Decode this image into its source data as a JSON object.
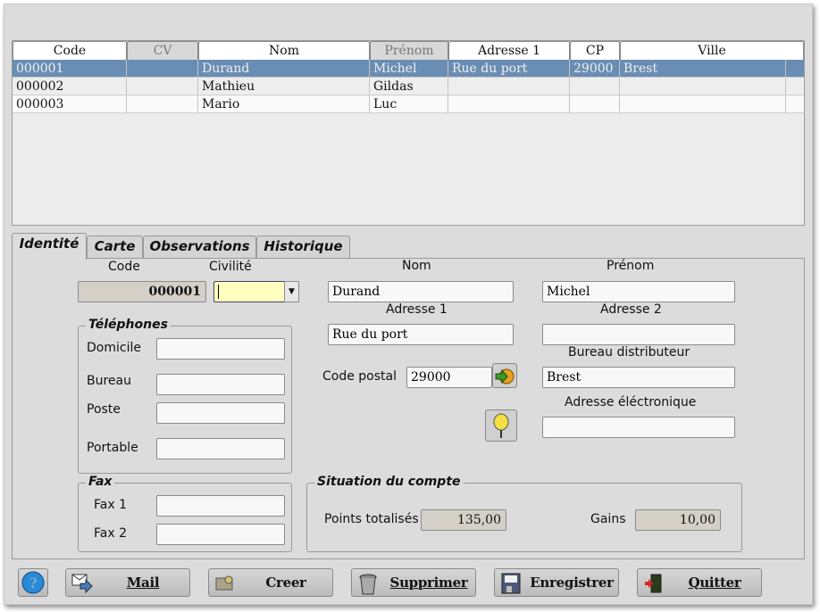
{
  "grid": {
    "columns": [
      "Code",
      "CV",
      "Nom",
      "Prénom",
      "Adresse 1",
      "CP",
      "Ville"
    ],
    "rows": [
      [
        "000001",
        "",
        "Durand",
        "Michel",
        "Rue du port",
        "29000",
        "Brest"
      ],
      [
        "000002",
        "",
        "Mathieu",
        "Gildas",
        "",
        "",
        ""
      ],
      [
        "000003",
        "",
        "Mario",
        "Luc",
        "",
        "",
        ""
      ]
    ],
    "selected_row": 0
  },
  "tabs": [
    "Identité",
    "Carte",
    "Observations",
    "Historique"
  ],
  "active_tab": "Identité",
  "form": {
    "code_label": "Code",
    "code_value": "000001",
    "civilite_label": "Civilité",
    "civilite_value": "",
    "nom_label": "Nom",
    "nom_value": "Durand",
    "prenom_label": "Prénom",
    "prenom_value": "Michel",
    "adresse1_label": "Adresse 1",
    "adresse1_value": "Rue du port",
    "adresse2_label": "Adresse 2",
    "adresse2_value": "",
    "cp_label": "Code postal",
    "cp_value": "29000",
    "bureau_label": "Bureau distributeur",
    "bureau_value": "Brest",
    "email_label": "Adresse éléctronique",
    "email_value": "",
    "telephones": {
      "title": "Téléphones",
      "domicile": "Domicile",
      "bureau": "Bureau",
      "poste": "Poste",
      "portable": "Portable"
    },
    "fax": {
      "title": "Fax",
      "fax1": "Fax 1",
      "fax2": "Fax 2"
    },
    "compte": {
      "title": "Situation du compte",
      "points_label": "Points totalisés",
      "points_value": "135,00",
      "gains_label": "Gains",
      "gains_value": "10,00"
    }
  },
  "buttons": {
    "mail": "Mail",
    "creer": "Creer",
    "supprimer": "Supprimer",
    "enregistrer": "Enregistrer",
    "quitter": "Quitter"
  },
  "colors": {
    "selection": "#6a8db3",
    "civilite_bg": "#ffffc0"
  }
}
